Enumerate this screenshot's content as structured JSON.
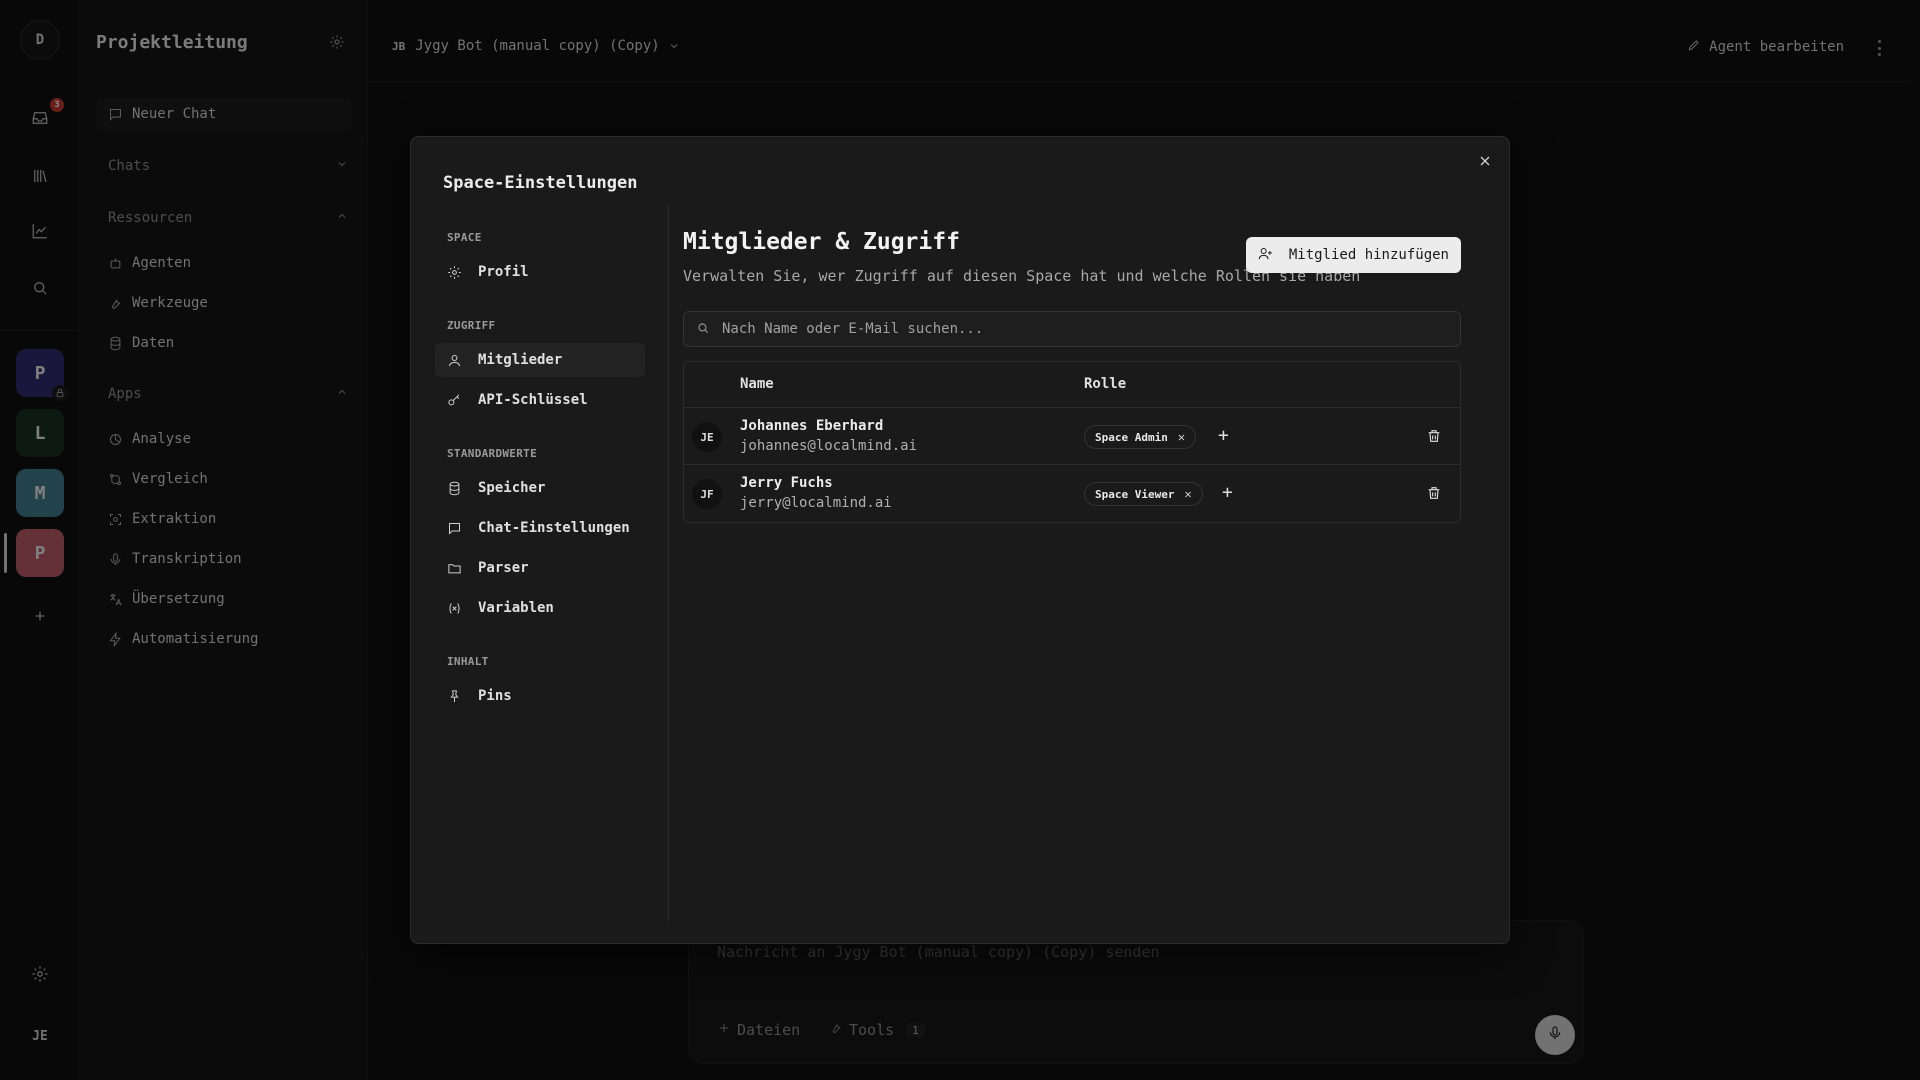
{
  "rail": {
    "top_avatar": "D",
    "inbox_badge": "3",
    "spaces": [
      {
        "letter": "P",
        "color": "#312b6e"
      },
      {
        "letter": "L",
        "color": "#16311f"
      },
      {
        "letter": "M",
        "color": "#3f7a8a"
      },
      {
        "letter": "P",
        "color": "#b95967"
      }
    ],
    "user_initials": "JE"
  },
  "sidebar": {
    "title": "Projektleitung",
    "new_chat": "Neuer Chat",
    "chats": "Chats",
    "resources": "Ressourcen",
    "resource_items": [
      "Agenten",
      "Werkzeuge",
      "Daten"
    ],
    "apps": "Apps",
    "app_items": [
      "Analyse",
      "Vergleich",
      "Extraktion",
      "Transkription",
      "Übersetzung",
      "Automatisierung"
    ]
  },
  "header": {
    "agent_initials": "JB",
    "agent_name": "Jygy Bot (manual copy) (Copy)",
    "edit_agent": "Agent bearbeiten"
  },
  "composer": {
    "placeholder": "Nachricht an Jygy Bot (manual copy) (Copy) senden",
    "files": "Dateien",
    "tools": "Tools",
    "tools_count": "1"
  },
  "modal": {
    "title": "Space-Einstellungen",
    "nav": {
      "space_section": "SPACE",
      "profile": "Profil",
      "access_section": "ZUGRIFF",
      "members": "Mitglieder",
      "api_keys": "API-Schlüssel",
      "defaults_section": "STANDARDWERTE",
      "storage": "Speicher",
      "chat_settings": "Chat-Einstellungen",
      "parser": "Parser",
      "variables": "Variablen",
      "content_section": "INHALT",
      "pins": "Pins"
    },
    "content": {
      "title": "Mitglieder & Zugriff",
      "subtitle": "Verwalten Sie, wer Zugriff auf diesen Space hat und welche Rollen sie haben",
      "add_member": "Mitglied hinzufügen",
      "search_placeholder": "Nach Name oder E-Mail suchen...",
      "columns": {
        "name": "Name",
        "role": "Rolle"
      },
      "members": [
        {
          "initials": "JE",
          "name": "Johannes Eberhard",
          "email": "johannes@localmind.ai",
          "role": "Space Admin"
        },
        {
          "initials": "JF",
          "name": "Jerry Fuchs",
          "email": "jerry@localmind.ai",
          "role": "Space Viewer"
        }
      ]
    }
  }
}
